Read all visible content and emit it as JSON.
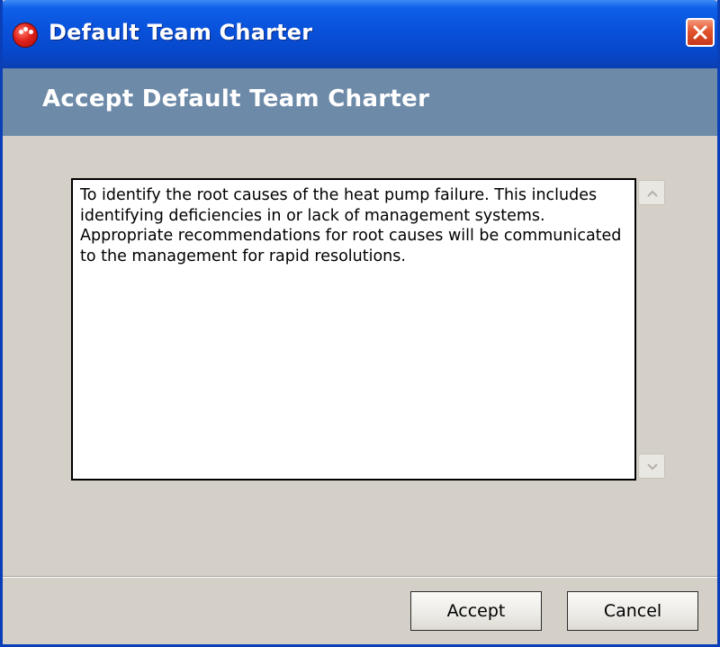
{
  "window": {
    "title": "Default Team Charter",
    "icon": "red-app-icon",
    "close_icon": "close-icon"
  },
  "header": {
    "title": "Accept Default Team Charter"
  },
  "charter": {
    "text": "To identify the root causes of the heat pump failure. This includes identifying deficiencies in or lack of management systems. Appropriate recommendations for root causes will be communicated to the management for rapid resolutions."
  },
  "scrollbar": {
    "up_icon": "chevron-up-icon",
    "down_icon": "chevron-down-icon"
  },
  "footer": {
    "accept_label": "Accept",
    "cancel_label": "Cancel"
  },
  "colors": {
    "titlebar": "#0851da",
    "header_band": "#6d8aa8",
    "dialog_bg": "#d4d0c8",
    "close_button": "#e2532d"
  }
}
